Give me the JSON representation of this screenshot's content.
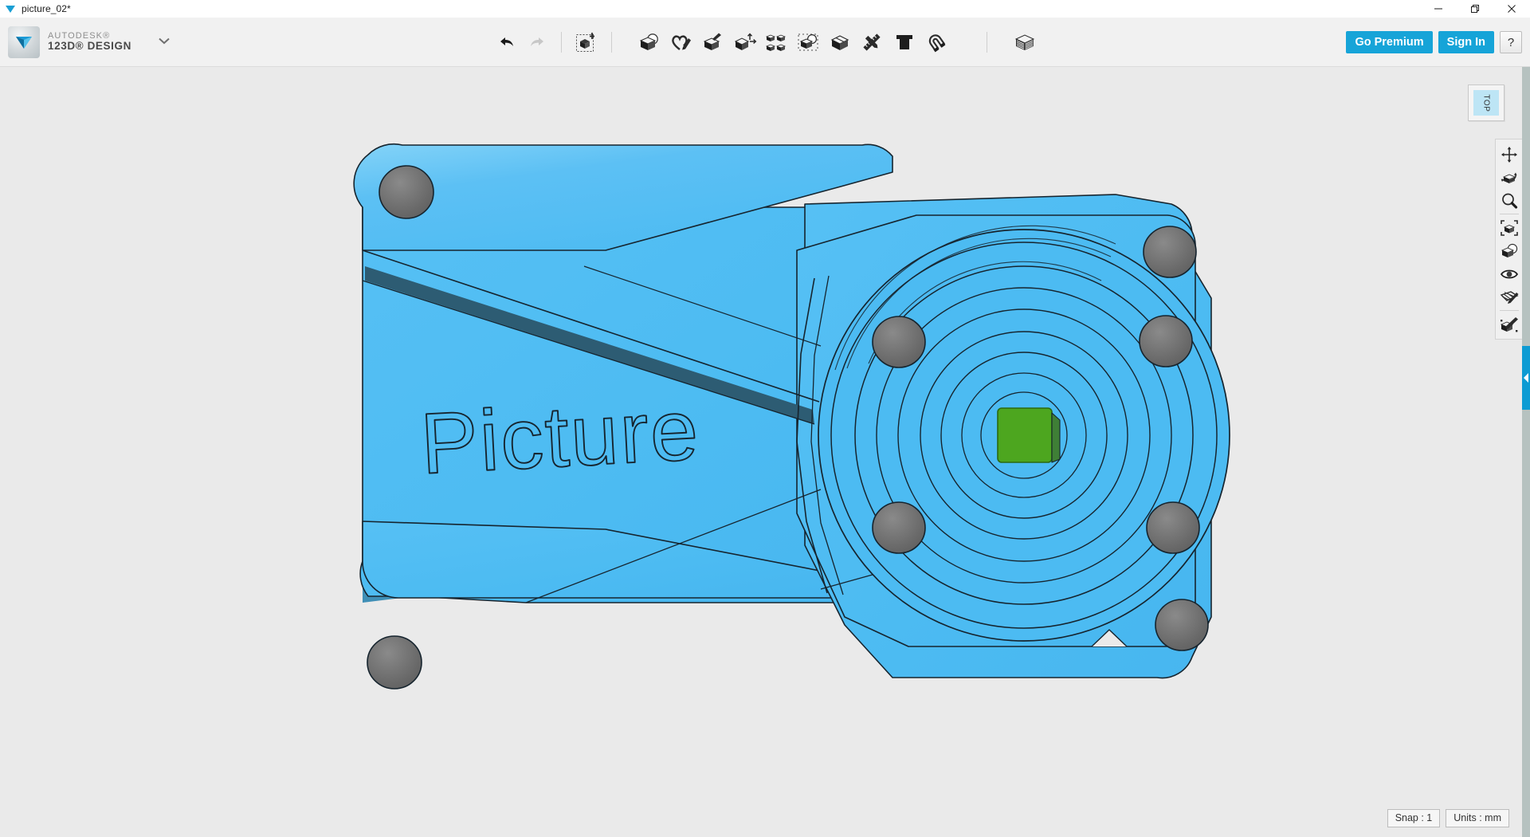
{
  "window": {
    "doc_title": "picture_02*",
    "logo_icon": "autodesk-triangle-icon",
    "controls": [
      {
        "name": "minimize-button",
        "icon": "minimize-icon",
        "label": "Minimize"
      },
      {
        "name": "restore-button",
        "icon": "restore-icon",
        "label": "Restore"
      },
      {
        "name": "close-button",
        "icon": "close-icon",
        "label": "Close"
      }
    ]
  },
  "brand": {
    "logo_icon": "autodesk-123d-logo-icon",
    "line1": "AUTODESK®",
    "line2": "123D® DESIGN",
    "menu_caret_icon": "chevron-down-icon"
  },
  "toolbar": {
    "history": [
      {
        "name": "undo-button",
        "icon": "undo-arrow-icon",
        "label": "Undo",
        "enabled": true
      },
      {
        "name": "redo-button",
        "icon": "redo-arrow-icon",
        "label": "Redo",
        "enabled": false
      }
    ],
    "transform": [
      {
        "name": "transform-tool",
        "icon": "cube-move-icon",
        "label": "Transform"
      }
    ],
    "tools": [
      {
        "name": "primitives-tool",
        "icon": "cube-sphere-icon",
        "label": "Primitives"
      },
      {
        "name": "sketch-tool",
        "icon": "sketch-pencil-icon",
        "label": "Sketch"
      },
      {
        "name": "construct-tool",
        "icon": "construct-cube-icon",
        "label": "Construct"
      },
      {
        "name": "modify-tool",
        "icon": "modify-cube-arrows-icon",
        "label": "Modify"
      },
      {
        "name": "pattern-tool",
        "icon": "pattern-four-cubes-icon",
        "label": "Pattern"
      },
      {
        "name": "grouping-tool",
        "icon": "grouping-cube-icon",
        "label": "Grouping"
      },
      {
        "name": "combine-tool",
        "icon": "combine-cube-icon",
        "label": "Combine"
      },
      {
        "name": "measure-tool",
        "icon": "measure-ruler-pencil-icon",
        "label": "Measure"
      },
      {
        "name": "text-tool",
        "icon": "text-t-icon",
        "label": "Text"
      },
      {
        "name": "snap-tool",
        "icon": "magnet-snap-icon",
        "label": "Snap"
      }
    ],
    "layers": [
      {
        "name": "layers-tool",
        "icon": "stacked-layers-icon",
        "label": "Layers"
      }
    ]
  },
  "account": {
    "go_premium_label": "Go Premium",
    "sign_in_label": "Sign In",
    "help_label": "?",
    "accent_color": "#16a4d8"
  },
  "viewcube": {
    "face_label": "TOP",
    "face_color": "#bde5f5"
  },
  "navbar": {
    "items": [
      {
        "name": "pan-tool",
        "icon": "pan-arrows-icon",
        "label": "Pan"
      },
      {
        "name": "orbit-tool",
        "icon": "orbit-cube-icon",
        "label": "Orbit"
      },
      {
        "name": "zoom-tool",
        "icon": "magnifier-zoom-icon",
        "label": "Zoom"
      },
      {
        "name": "fit-tool",
        "icon": "fit-to-view-icon",
        "label": "Fit"
      },
      {
        "name": "display-mode-tool",
        "icon": "display-mode-cube-icon",
        "label": "Display Mode"
      },
      {
        "name": "visibility-tool",
        "icon": "eye-visibility-icon",
        "label": "Visibility"
      },
      {
        "name": "grid-snap-tool",
        "icon": "grid-pencil-icon",
        "label": "Grid / Snaps"
      },
      {
        "name": "smart-scale-tool",
        "icon": "smart-scale-icon",
        "label": "Smart Scale"
      }
    ]
  },
  "panel_handle": {
    "name": "right-panel-expander",
    "icon": "chevron-left-icon",
    "color": "#0d9bd3"
  },
  "status": {
    "snap_label": "Snap : 1",
    "units_label": "Units : mm"
  },
  "model": {
    "name": "picture-frame-bracket-model",
    "engraved_text": "Picture",
    "body_color": "#4cbbf2",
    "body_color_light": "#72cbf7",
    "body_color_shade": "#3faeea",
    "hole_color": "#6b6b6b",
    "selected_face_color": "#4da61f",
    "edge_color": "#0e1a24",
    "background_color": "#eaeaea",
    "hole_count": 6
  }
}
